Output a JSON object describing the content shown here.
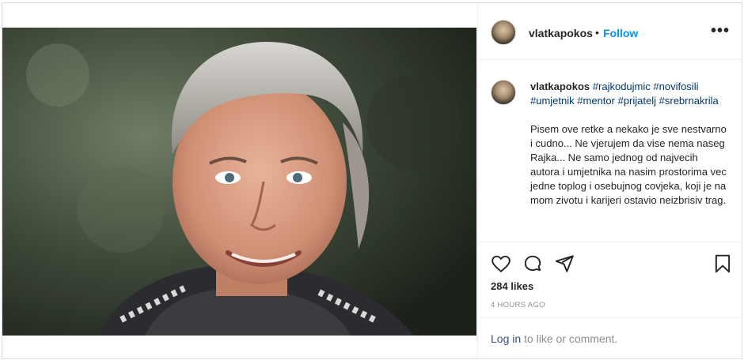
{
  "post": {
    "username": "vlatkapokos",
    "separator": "•",
    "follow_label": "Follow",
    "more_icon": "more-options-icon",
    "more_glyph": "•••"
  },
  "caption": {
    "username": "vlatkapokos",
    "hashtags": [
      "#rajkodujmic",
      "#novifosili",
      "#umjetnik",
      "#mentor",
      "#prijatelj",
      "#srebrnakrila"
    ],
    "body": "Pisem ove retke a nekako je sve nestvarno i cudno... Ne vjerujem da vise nema naseg Rajka... Ne samo jednog od najvecih autora i umjetnika na nasim prostorima vec jedne toplog i osebujnog covjeka, koji je na mom zivotu i karijeri ostavio neizbrisiv trag."
  },
  "actions": {
    "like_icon": "heart-icon",
    "comment_icon": "comment-icon",
    "share_icon": "send-icon",
    "save_icon": "bookmark-icon",
    "likes_text": "284 likes",
    "time_text": "4 HOURS AGO"
  },
  "comment": {
    "login_label": "Log in",
    "rest_text": " to like or comment."
  }
}
